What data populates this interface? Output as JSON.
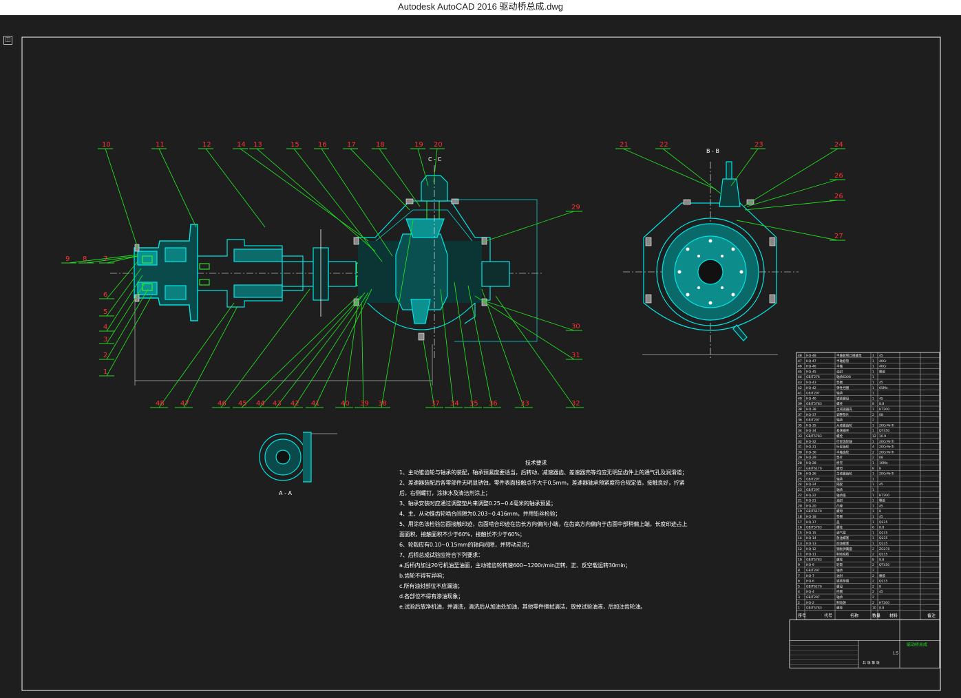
{
  "window": {
    "title": "Autodesk AutoCAD 2016     驱动桥总成.dwg",
    "corner_glyph": "◫"
  },
  "drawing": {
    "section_labels": {
      "cc": "C - C",
      "bb": "B - B",
      "aa": "A - A"
    },
    "balloons_top_left": [
      "10",
      "11",
      "12",
      "14",
      "13",
      "15",
      "16",
      "17",
      "18",
      "19",
      "20"
    ],
    "balloons_top_right": [
      "21",
      "22",
      "23",
      "24"
    ],
    "balloons_right_bb": [
      "26",
      "26",
      "27"
    ],
    "balloons_left": [
      "9",
      "8",
      "7",
      "6",
      "5",
      "4",
      "3",
      "2",
      "1"
    ],
    "balloon_29": "29",
    "balloon_30": "30",
    "balloon_31": "31",
    "balloons_bottom": [
      "48",
      "47",
      "46",
      "45",
      "44",
      "43",
      "42",
      "41",
      "40",
      "39",
      "38",
      "37",
      "34",
      "35",
      "36",
      "33",
      "32"
    ],
    "colors": {
      "border": "#ffffff",
      "outline": "#00e5e5",
      "leader": "#22dd22",
      "balloon_text": "#ff3030",
      "hatch": "#00c8c8",
      "dimension": "#ffffff",
      "gear_green": "#33ff33",
      "table_header": "#22dd22"
    }
  },
  "notes": {
    "heading": "技术要求",
    "lines": [
      "1、主动锥齿轮与轴承的装配，轴承预紧度要适当，后转动，减速器齿、差速器壳等均应无明显齿件上的通气孔及润滑道；",
      "2、差速器装配后各零部件无明显锈蚀，零件表面接触点不大于0.5mm，差速器轴承预紧度符合规定值，接触良好，拧紧",
      "   后，右侧螺钉，涂抹水及清洁剂涂上；",
      "3、轴承安装时应通过调整垫片来调整0.25~0.4毫米的轴承预紧；",
      "4、主、从动锥齿轮啮合间隙为0.203~0.416mm，并用铅丝检验；",
      "5、用涂色法检验齿面接触印迹，齿面啮合印迹在齿长方向偏向小端，在齿高方向偏向于齿面中部稍偏上端，长度印迹占上",
      "   面面积，接触面积不少于60%，接触长不少于60%；",
      "6、轮毂应有0.10~0.15mm的轴向间隙，并转动灵活；",
      "7、后桥总成试验应符合下列要求：",
      "   a.后桥内加注20号机油至油面，主动锥齿轮转速600~1200r/min正转，正、反空载运转30min；",
      "   b.齿轮不得有异响；",
      "   c.所有油封部位不应漏油；",
      "   d.各部位不得有渗油现象；",
      "   e.试验后放净机油，并清洗，清洗后从加油处加油，其他零件擦拭清洁，放掉试验油液，后加注齿轮油。"
    ]
  },
  "bom": {
    "rows": [
      [
        "48",
        "HQ-48",
        "半轴套管凸缘螺母",
        "1",
        "45",
        ""
      ],
      [
        "47",
        "HQ-47",
        "半轴套管",
        "1",
        "40Cr",
        ""
      ],
      [
        "46",
        "HQ-46",
        "半轴",
        "1",
        "40Cr",
        ""
      ],
      [
        "45",
        "HQ-45",
        "油封",
        "1",
        "橡胶",
        ""
      ],
      [
        "44",
        "GB/T276",
        "轴承6308",
        "1",
        "",
        ""
      ],
      [
        "43",
        "HQ-43",
        "垫圈",
        "1",
        "45",
        ""
      ],
      [
        "42",
        "HQ-42",
        "弹性挡圈",
        "1",
        "65Mn",
        ""
      ],
      [
        "41",
        "GB/T297",
        "轴承",
        "1",
        "",
        ""
      ],
      [
        "40",
        "HQ-40",
        "锁紧螺母",
        "1",
        "45",
        ""
      ],
      [
        "39",
        "GB/T5783",
        "螺栓",
        "8",
        "8.8",
        ""
      ],
      [
        "38",
        "HQ-38",
        "主减速器壳",
        "1",
        "HT200",
        ""
      ],
      [
        "37",
        "HQ-37",
        "调整垫片",
        "2",
        "08",
        ""
      ],
      [
        "36",
        "GB/T297",
        "轴承",
        "2",
        "",
        ""
      ],
      [
        "35",
        "HQ-35",
        "从动锥齿轮",
        "1",
        "20CrMnTi",
        ""
      ],
      [
        "34",
        "HQ-34",
        "差速器壳",
        "1",
        "QT450",
        ""
      ],
      [
        "33",
        "GB/T5783",
        "螺栓",
        "12",
        "10.9",
        ""
      ],
      [
        "32",
        "HQ-32",
        "行星齿轮轴",
        "1",
        "20CrMnTi",
        ""
      ],
      [
        "31",
        "HQ-31",
        "行星齿轮",
        "4",
        "20CrMnTi",
        ""
      ],
      [
        "30",
        "HQ-30",
        "半轴齿轮",
        "2",
        "20CrMnTi",
        ""
      ],
      [
        "29",
        "HQ-29",
        "垫片",
        "2",
        "08",
        ""
      ],
      [
        "28",
        "HQ-28",
        "桥壳",
        "1",
        "16Mn",
        ""
      ],
      [
        "27",
        "GB/T6170",
        "螺母",
        "8",
        "8",
        ""
      ],
      [
        "26",
        "HQ-26",
        "主动锥齿轮",
        "1",
        "20CrMnTi",
        ""
      ],
      [
        "25",
        "GB/T297",
        "轴承",
        "1",
        "",
        ""
      ],
      [
        "24",
        "HQ-24",
        "隔套",
        "1",
        "45",
        ""
      ],
      [
        "23",
        "GB/T297",
        "轴承",
        "1",
        "",
        ""
      ],
      [
        "22",
        "HQ-22",
        "轴承座",
        "1",
        "HT200",
        ""
      ],
      [
        "21",
        "HQ-21",
        "油封",
        "1",
        "橡胶",
        ""
      ],
      [
        "20",
        "HQ-20",
        "凸缘",
        "1",
        "45",
        ""
      ],
      [
        "19",
        "GB/T6170",
        "螺母",
        "1",
        "8",
        ""
      ],
      [
        "18",
        "HQ-18",
        "垫圈",
        "1",
        "45",
        ""
      ],
      [
        "17",
        "HQ-17",
        "盖",
        "1",
        "Q235",
        ""
      ],
      [
        "16",
        "GB/T5783",
        "螺栓",
        "6",
        "8.8",
        ""
      ],
      [
        "15",
        "HQ-15",
        "通气塞",
        "1",
        "Q235",
        ""
      ],
      [
        "14",
        "HQ-14",
        "放油螺塞",
        "1",
        "Q235",
        ""
      ],
      [
        "13",
        "HQ-13",
        "加油螺塞",
        "1",
        "Q235",
        ""
      ],
      [
        "12",
        "HQ-12",
        "钢板弹簧座",
        "2",
        "ZG270",
        ""
      ],
      [
        "11",
        "HQ-11",
        "制动底板",
        "2",
        "Q235",
        ""
      ],
      [
        "10",
        "GB/T5783",
        "螺栓",
        "8",
        "8.8",
        ""
      ],
      [
        "9",
        "HQ-9",
        "轮毂",
        "2",
        "QT450",
        ""
      ],
      [
        "8",
        "GB/T297",
        "轴承",
        "2",
        "",
        ""
      ],
      [
        "7",
        "HQ-7",
        "油封",
        "2",
        "橡胶",
        ""
      ],
      [
        "6",
        "HQ-6",
        "锁紧垫圈",
        "2",
        "Q235",
        ""
      ],
      [
        "5",
        "GB/T6170",
        "螺母",
        "2",
        "8",
        ""
      ],
      [
        "4",
        "HQ-4",
        "挡圈",
        "2",
        "45",
        ""
      ],
      [
        "3",
        "GB/T297",
        "轴承",
        "2",
        "",
        ""
      ],
      [
        "2",
        "HQ-2",
        "制动鼓",
        "2",
        "HT200",
        ""
      ],
      [
        "1",
        "GB/T5783",
        "螺栓",
        "10",
        "8.8",
        ""
      ]
    ],
    "header": [
      "序号",
      "代号",
      "名称",
      "数量",
      "材料",
      "备注"
    ],
    "title_block": {
      "name": "驱动桥总成",
      "scale": "1:5",
      "sheet": "共 张 第 张"
    }
  }
}
